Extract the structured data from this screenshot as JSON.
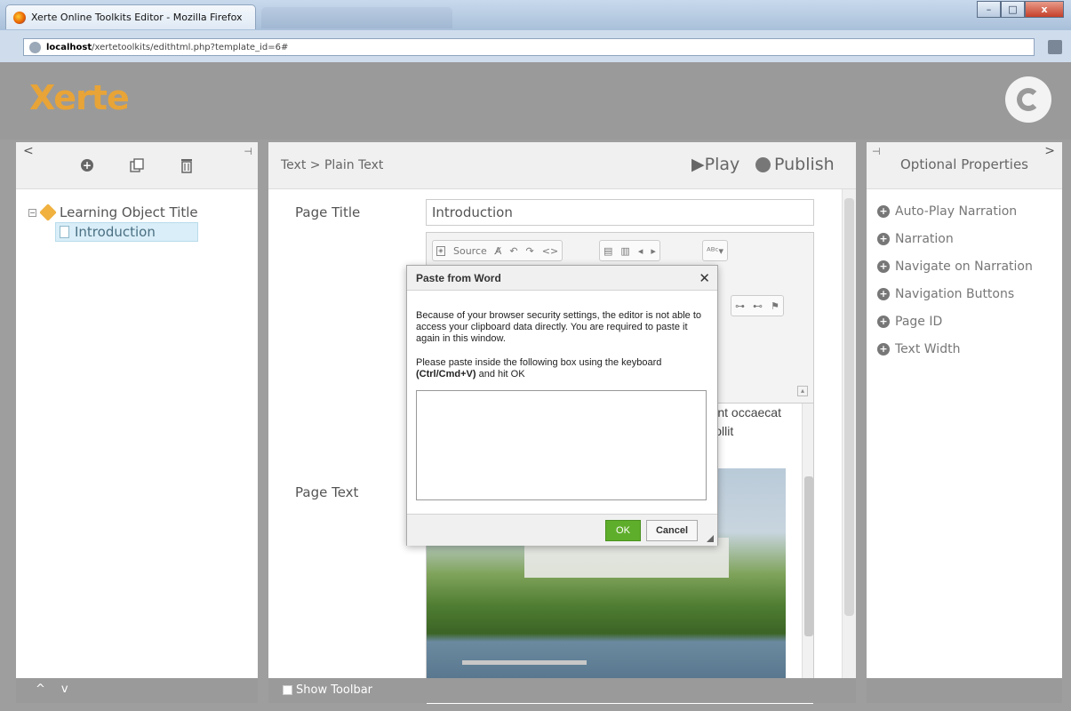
{
  "browser": {
    "tab_title": "Xerte Online Toolkits Editor - Mozilla Firefox",
    "url_host": "localhost",
    "url_path": "/xertetoolkits/edithtml.php?template_id=6#",
    "win_minimize": "–",
    "win_maximize": "□",
    "win_close": "x"
  },
  "header": {
    "logo_text": "Xerte"
  },
  "left_panel": {
    "collapse_glyph": "<",
    "pin_glyph": "⊣",
    "tree": {
      "root_label": "Learning Object Title",
      "child_label": "Introduction"
    },
    "footer_up": "^",
    "footer_down": "v"
  },
  "center_panel": {
    "breadcrumb": "Text > Plain Text",
    "play_label": "Play",
    "publish_label": "Publish",
    "page_title_label": "Page Title",
    "page_title_value": "Introduction",
    "page_text_label": "Page Text",
    "source_label": "Source",
    "editor_text": "velit esse int occaecat eserunt mollit",
    "show_toolbar_label": "Show Toolbar"
  },
  "right_panel": {
    "title": "Optional Properties",
    "pin_glyph": "⊣",
    "expand_glyph": ">",
    "items": [
      "Auto-Play Narration",
      "Narration",
      "Navigate on Narration",
      "Navigation Buttons",
      "Page ID",
      "Text Width"
    ]
  },
  "dialog": {
    "title": "Paste from Word",
    "close_glyph": "✕",
    "message": "Because of your browser security settings, the editor is not able to access your clipboard data directly. You are required to paste it again in this window.",
    "instruction_pre": "Please paste inside the following box using the keyboard ",
    "instruction_keys": "(Ctrl/Cmd+V)",
    "instruction_post": " and hit OK",
    "ok_label": "OK",
    "cancel_label": "Cancel"
  }
}
